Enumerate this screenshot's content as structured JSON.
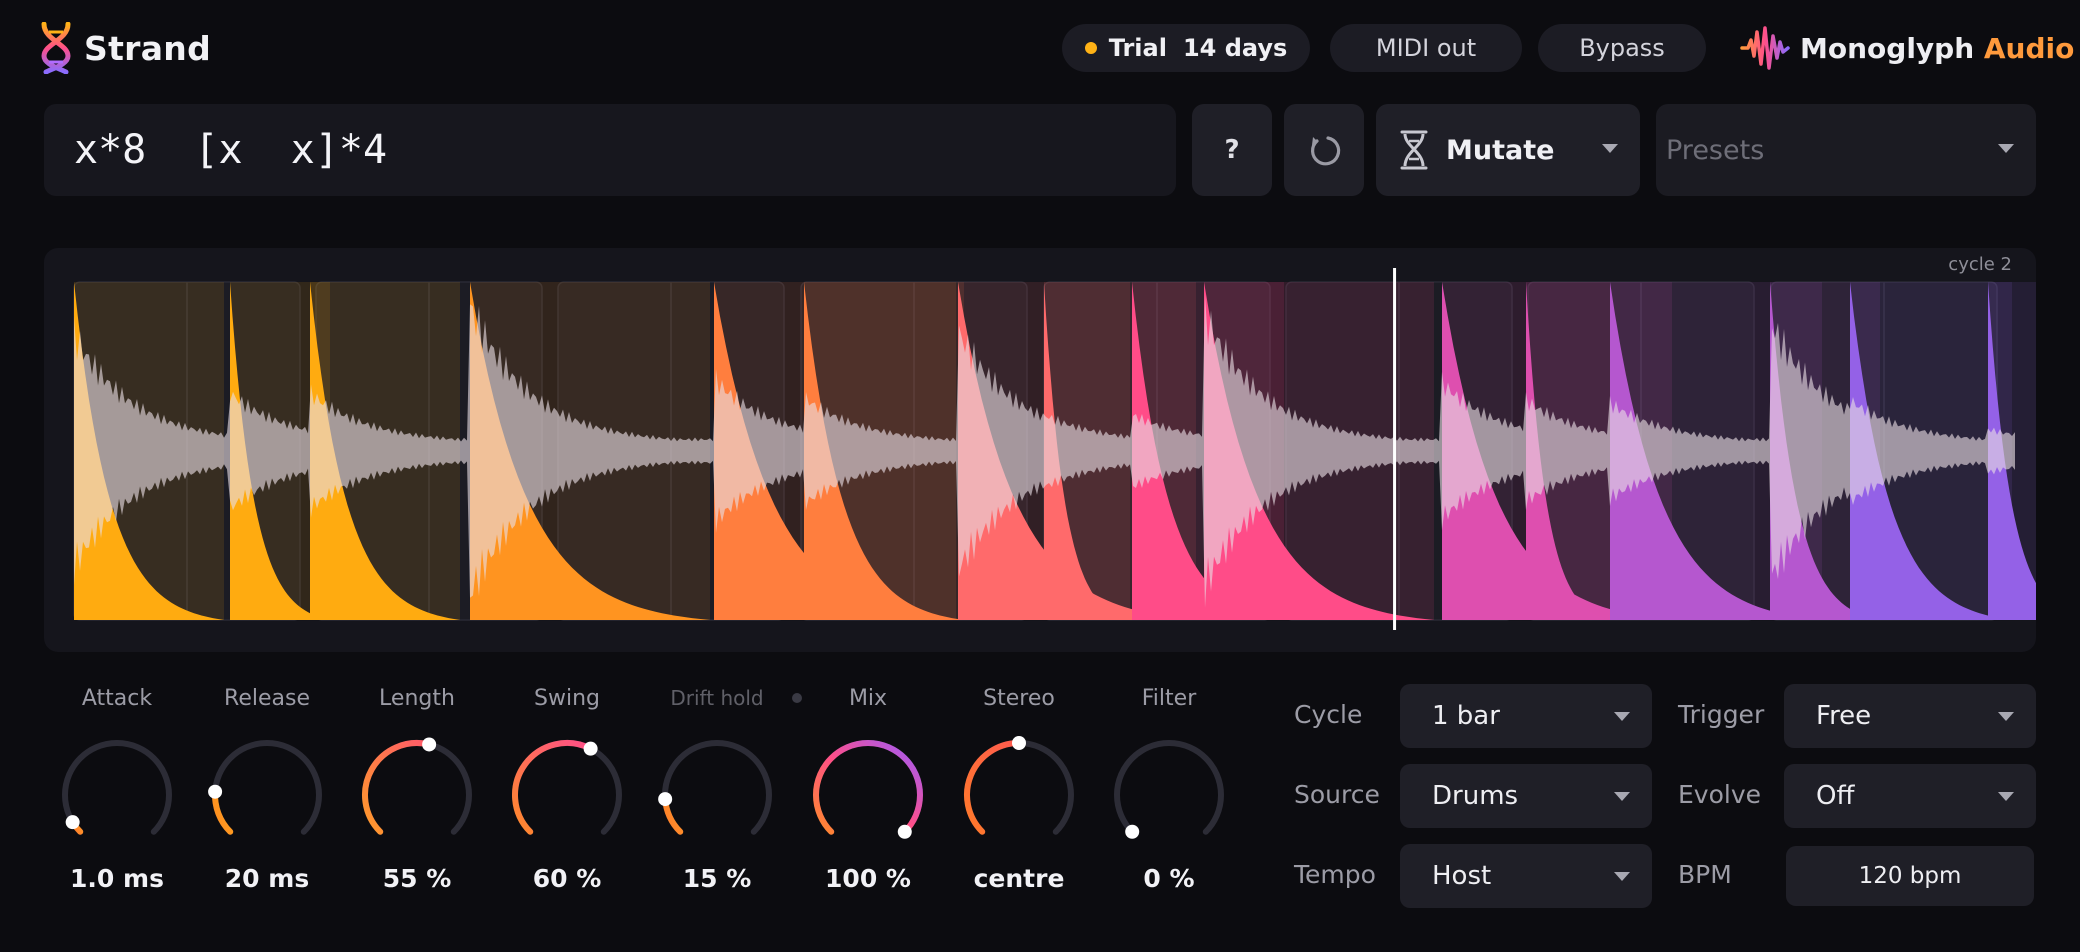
{
  "header": {
    "brand": "Strand",
    "trial_label": "Trial",
    "trial_days": "14 days",
    "midi_out": "MIDI out",
    "bypass": "Bypass",
    "company_name": "Monoglyph",
    "company_accent": "Audio"
  },
  "pattern": {
    "text": "x*8  [x  x]*4"
  },
  "buttons": {
    "help": "?",
    "mutate": "Mutate"
  },
  "presets": {
    "placeholder": "Presets"
  },
  "waveform": {
    "cycle_label": "cycle 2",
    "playhead_position": 0.68
  },
  "knobs": [
    {
      "label": "Attack",
      "value": "1.0 ms",
      "level": 0.05,
      "colors": [
        "#ff7a2a",
        "#ff9a2a"
      ]
    },
    {
      "label": "Release",
      "value": "20 ms",
      "level": 0.18,
      "colors": [
        "#ff8a20",
        "#ffa520"
      ]
    },
    {
      "label": "Length",
      "value": "55 %",
      "level": 0.55,
      "colors": [
        "#ff9a2a",
        "#ff5a6a"
      ]
    },
    {
      "label": "Swing",
      "value": "60 %",
      "level": 0.6,
      "colors": [
        "#ff8a2a",
        "#ff4f8a"
      ]
    },
    {
      "label": "Drift hold",
      "value": "15 %",
      "level": 0.15,
      "colors": [
        "#ff7a2a",
        "#ff9a2a"
      ]
    },
    {
      "label": "Mix",
      "value": "100 %",
      "level": 1.0,
      "colors": [
        "#ff8a2a",
        "#ff4f8a",
        "#9a5cff"
      ]
    },
    {
      "label": "Stereo",
      "value": "centre",
      "level": 0.5,
      "colors": [
        "#ff7a2a",
        "#ff5a50"
      ]
    },
    {
      "label": "Filter",
      "value": "0 %",
      "level": 0.0,
      "colors": [
        "#ff7a2a",
        "#ff9a2a"
      ]
    }
  ],
  "settings": {
    "cycle": {
      "label": "Cycle",
      "value": "1 bar"
    },
    "source": {
      "label": "Source",
      "value": "Drums"
    },
    "tempo": {
      "label": "Tempo",
      "value": "Host"
    },
    "trigger": {
      "label": "Trigger",
      "value": "Free"
    },
    "evolve": {
      "label": "Evolve",
      "value": "Off"
    },
    "bpm": {
      "label": "BPM",
      "value": "120 bpm"
    }
  },
  "colors": {
    "accent_orange": "#ffb216",
    "accent_purple": "#8a6cff",
    "background": "#0c0c10",
    "panel": "#15151c"
  }
}
